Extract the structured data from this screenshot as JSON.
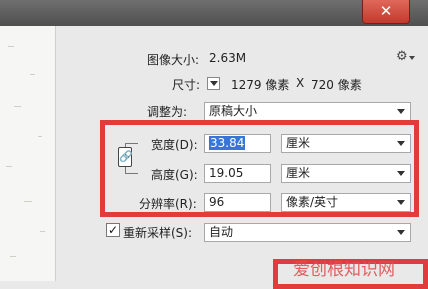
{
  "window": {
    "close_glyph": "✕"
  },
  "image_size": {
    "label": "图像大小:",
    "value": "2.63M"
  },
  "dimensions": {
    "label": "尺寸:",
    "width": "1279 像素",
    "separator": "X",
    "height": "720 像素"
  },
  "fit_to": {
    "label": "调整为:",
    "value": "原稿大小"
  },
  "width": {
    "label": "宽度(D):",
    "value": "33.84",
    "unit": "厘米"
  },
  "height": {
    "label": "高度(G):",
    "value": "19.05",
    "unit": "厘米"
  },
  "resolution": {
    "label": "分辨率(R):",
    "value": "96",
    "unit": "像素/英寸"
  },
  "resample": {
    "label": "重新采样(S):",
    "checked": true,
    "check_glyph": "✓",
    "value": "自动"
  },
  "icons": {
    "gear": "gear-icon",
    "link": "link-icon",
    "dropdown": "chevron-down-icon"
  },
  "watermark": {
    "text": "爱创根知识网"
  },
  "colors": {
    "highlight": "#e23b3b",
    "selection": "#3875d7",
    "close_button": "#c13a2c"
  }
}
